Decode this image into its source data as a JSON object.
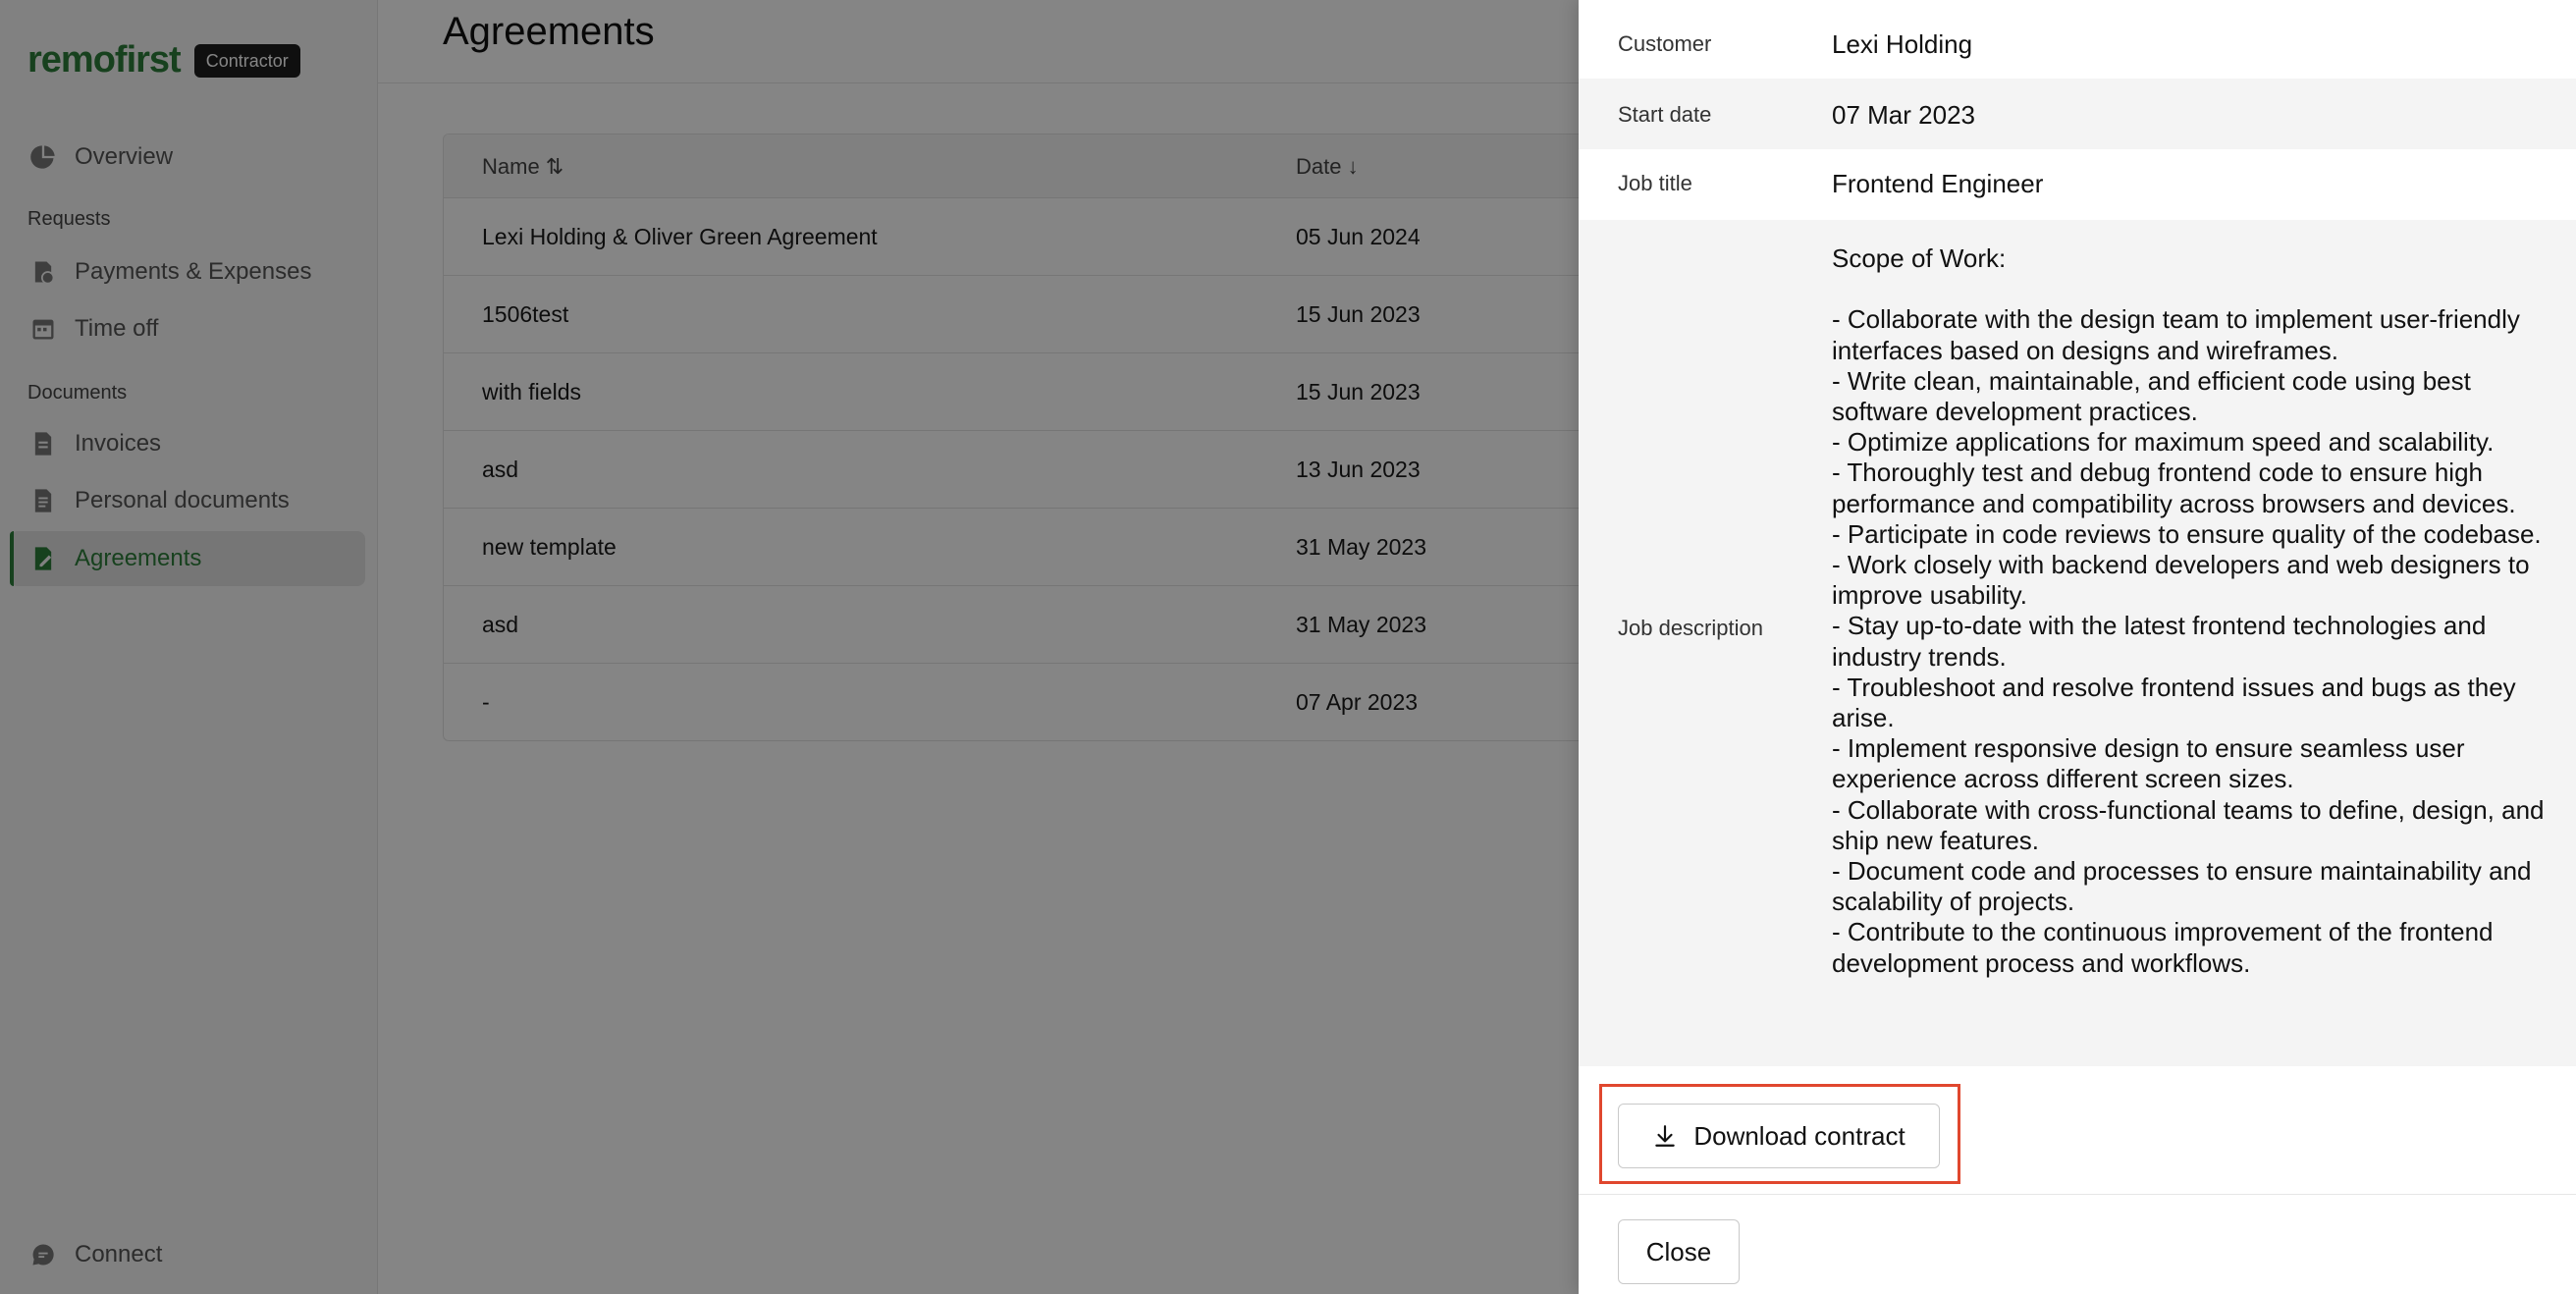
{
  "brand": {
    "logo": "remofirst",
    "role_badge": "Contractor"
  },
  "sidebar": {
    "items": [
      {
        "label": "Overview",
        "icon": "pie-chart-icon"
      },
      {
        "label": "Payments & Expenses",
        "icon": "coins-icon"
      },
      {
        "label": "Time off",
        "icon": "calendar-icon"
      },
      {
        "label": "Invoices",
        "icon": "invoice-icon"
      },
      {
        "label": "Personal documents",
        "icon": "document-icon"
      },
      {
        "label": "Agreements",
        "icon": "agreement-icon",
        "active": true
      }
    ],
    "sections": {
      "requests": "Requests",
      "documents": "Documents"
    },
    "connect_label": "Connect"
  },
  "page": {
    "title": "Agreements"
  },
  "table": {
    "headers": {
      "name": "Name ⇅",
      "date": "Date ↓"
    },
    "rows": [
      {
        "name": "Lexi Holding & Oliver Green Agreement",
        "date": "05 Jun 2024"
      },
      {
        "name": "1506test",
        "date": "15 Jun 2023"
      },
      {
        "name": "with fields",
        "date": "15 Jun 2023"
      },
      {
        "name": "asd",
        "date": "13 Jun 2023"
      },
      {
        "name": "new template",
        "date": "31 May 2023"
      },
      {
        "name": "asd",
        "date": "31 May 2023"
      },
      {
        "name": "-",
        "date": "07 Apr 2023"
      }
    ]
  },
  "drawer": {
    "customer": {
      "label": "Customer",
      "value": "Lexi Holding"
    },
    "start_date": {
      "label": "Start date",
      "value": "07 Mar 2023"
    },
    "job_title": {
      "label": "Job title",
      "value": "Frontend Engineer"
    },
    "job_description": {
      "label": "Job description",
      "value": "Scope of Work:\n\n- Collaborate with the design team to implement user-friendly interfaces based on designs and wireframes.\n- Write clean, maintainable, and efficient code using best software development practices.\n- Optimize applications for maximum speed and scalability.\n- Thoroughly test and debug frontend code to ensure high performance and compatibility across browsers and devices.\n- Participate in code reviews to ensure quality of the codebase.\n- Work closely with backend developers and web designers to improve usability.\n- Stay up-to-date with the latest frontend technologies and industry trends.\n- Troubleshoot and resolve frontend issues and bugs as they arise.\n- Implement responsive design to ensure seamless user experience across different screen sizes.\n- Collaborate with cross-functional teams to define, design, and ship new features.\n- Document code and processes to ensure maintainability and scalability of projects.\n- Contribute to the continuous improvement of the frontend development process and workflows."
    },
    "download_label": "Download contract",
    "close_label": "Close"
  },
  "colors": {
    "brand_green": "#2d7d3a",
    "highlight": "#e0472e"
  }
}
